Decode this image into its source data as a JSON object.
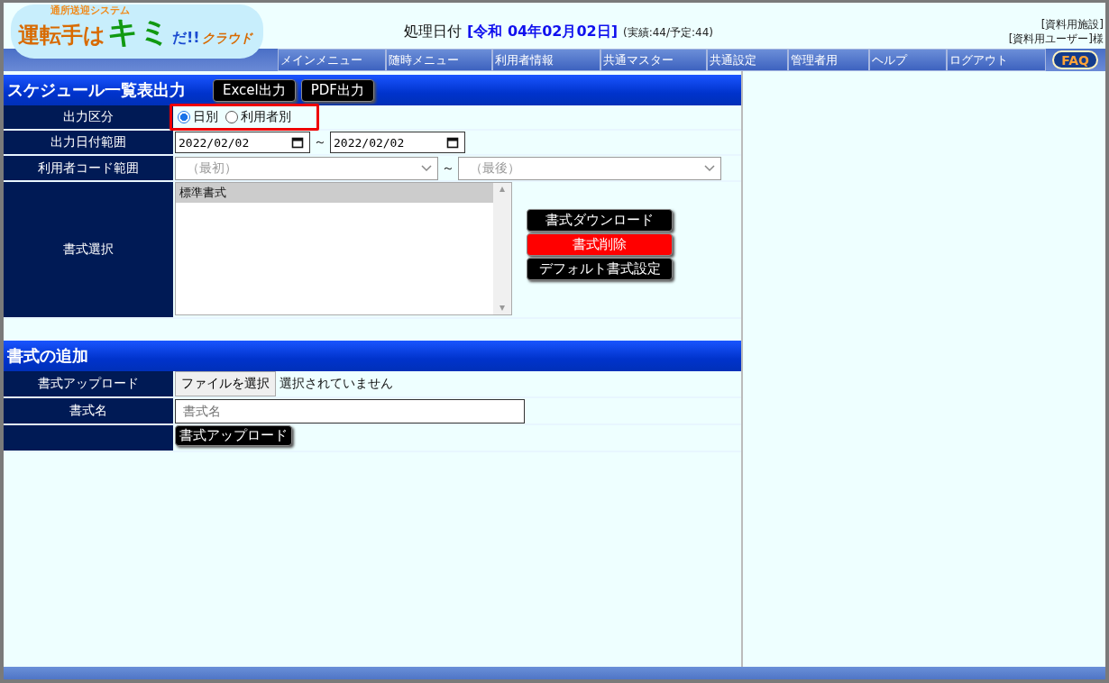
{
  "logo": {
    "tagline": "通所送迎システム",
    "main": "運転手は",
    "accent": "キミ",
    "exclaim": "だ!!",
    "cloud": "クラウド"
  },
  "processing": {
    "label": "処理日付",
    "date": "[令和 04年02月02日]",
    "counts": "(実績:44/予定:44)"
  },
  "user": {
    "facility": "[資料用施設]",
    "name": "[資料用ユーザー]様"
  },
  "nav": [
    "メインメニュー",
    "随時メニュー",
    "利用者情報",
    "共通マスター",
    "共通設定",
    "管理者用",
    "ヘルプ",
    "ログアウト"
  ],
  "faq": "FAQ",
  "schedule": {
    "title": "スケジュール一覧表出力",
    "buttons": [
      "Excel出力",
      "PDF出力"
    ],
    "output_type": {
      "label": "出力区分",
      "options": [
        {
          "label": "日別",
          "selected": true
        },
        {
          "label": "利用者別",
          "selected": false
        }
      ]
    },
    "date_range": {
      "label": "出力日付範囲",
      "from": "2022/02/02",
      "separator": "～",
      "to": "2022/02/02"
    },
    "user_range": {
      "label": "利用者コード範囲",
      "from": "（最初）",
      "separator": "～",
      "to": "（最後）"
    },
    "format": {
      "label": "書式選択",
      "items": [
        {
          "label": "標準書式",
          "selected": true
        }
      ],
      "actions": [
        {
          "label": "書式ダウンロード",
          "kind": "normal"
        },
        {
          "label": "書式削除",
          "kind": "danger"
        },
        {
          "label": "デフォルト書式設定",
          "kind": "normal"
        }
      ]
    }
  },
  "add_format": {
    "title": "書式の追加",
    "upload": {
      "label": "書式アップロード",
      "button": "ファイルを選択",
      "status": "選択されていません"
    },
    "name": {
      "label": "書式名",
      "placeholder": "書式名"
    },
    "submit": "書式アップロード"
  }
}
